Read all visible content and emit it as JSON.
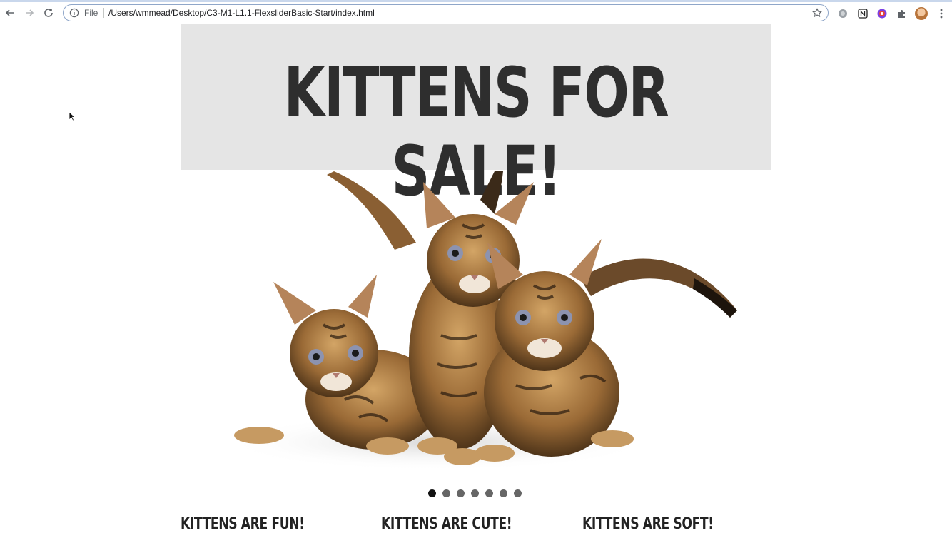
{
  "browser": {
    "scheme_label": "File",
    "url": "/Users/wmmead/Desktop/C3-M1-L1.1-FlexsliderBasic-Start/index.html"
  },
  "page": {
    "hero_title": "KITTENS FOR SALE!",
    "slider": {
      "image_alt": "Three striped bengal kittens",
      "dot_count": 7,
      "active_index": 0
    },
    "columns": [
      {
        "title": "KITTENS ARE FUN!"
      },
      {
        "title": "KITTENS ARE CUTE!"
      },
      {
        "title": "KITTENS ARE SOFT!"
      }
    ]
  },
  "colors": {
    "hero_bg": "#e5e5e5",
    "hero_text": "#2e2e2e",
    "dot": "#666666",
    "dot_active": "#111111"
  }
}
